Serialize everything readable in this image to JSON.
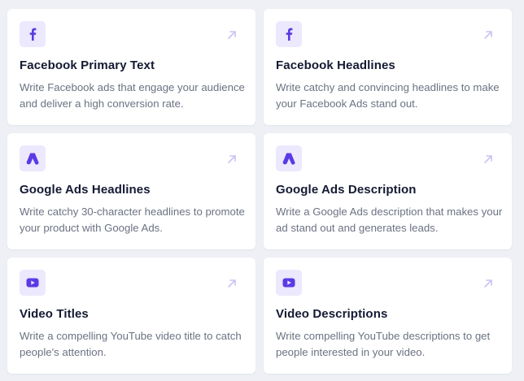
{
  "colors": {
    "accent": "#5b3ae6",
    "icon_bg": "#ece8fd",
    "arrow": "#c9c2f2",
    "title": "#141a33",
    "desc": "#6b7282"
  },
  "cards": [
    {
      "icon": "facebook-icon",
      "title": "Facebook Primary Text",
      "description": "Write Facebook ads that engage your audience and deliver a high conversion rate."
    },
    {
      "icon": "facebook-icon",
      "title": "Facebook Headlines",
      "description": "Write catchy and convincing headlines to make your Facebook Ads stand out."
    },
    {
      "icon": "google-ads-icon",
      "title": "Google Ads Headlines",
      "description": "Write catchy 30-character headlines to promote your product with Google Ads."
    },
    {
      "icon": "google-ads-icon",
      "title": "Google Ads Description",
      "description": "Write a Google Ads description that makes your ad stand out and generates leads."
    },
    {
      "icon": "youtube-icon",
      "title": "Video Titles",
      "description": "Write a compelling YouTube video title to catch people's attention."
    },
    {
      "icon": "youtube-icon",
      "title": "Video Descriptions",
      "description": "Write compelling YouTube descriptions to get people interested in your video."
    }
  ]
}
